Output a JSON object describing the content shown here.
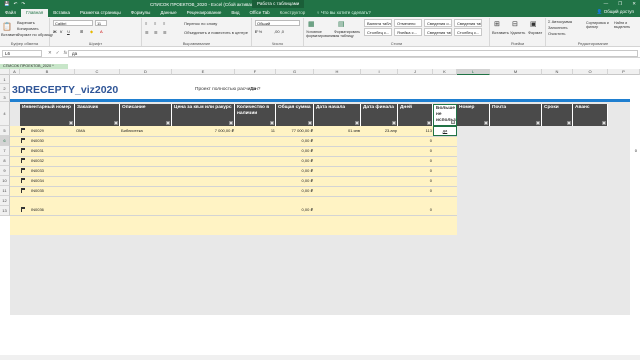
{
  "app": {
    "title": "СПИСОК ПРОЕКТОВ_2020 - Excel (Сбой активации продукта)",
    "context_tab": "Работа с таблицами",
    "window": {
      "minimize": "—",
      "restore": "❐",
      "close": "✕"
    }
  },
  "qat": {
    "save": "💾",
    "undo": "↶",
    "redo": "↷"
  },
  "tabs": [
    "Файл",
    "Главная",
    "Вставка",
    "Разметка страницы",
    "Формулы",
    "Данные",
    "Рецензирование",
    "Вид",
    "Office Tab",
    "Конструктор"
  ],
  "tellme": "♀ Что вы хотите сделать?",
  "share": "👤 Общий доступ",
  "ribbon": {
    "clipboard": {
      "name": "Буфер обмена",
      "paste": "Вставить",
      "cut": "Вырезать",
      "copy": "Копировать",
      "format": "Формат по образцу"
    },
    "font": {
      "name": "Шрифт",
      "font_value": "Calibri",
      "size_value": "11"
    },
    "alignment": {
      "name": "Выравнивание",
      "wrap": "Перенос по слову",
      "merge": "Объединить и поместить в центре"
    },
    "number": {
      "name": "Число",
      "format_value": "Общий"
    },
    "styles": {
      "name": "Стили",
      "conditional": "Условное форматирование",
      "as_table": "Форматировать как таблицу",
      "items": [
        "Валюта табл...",
        "Отмечено",
        "Сведения о...",
        "Сведения табл...",
        "Столбец с...",
        "Ячейка с...",
        "Сведения табл...",
        "Столбец с...",
        "Сведения о...",
        "Ячейка с..."
      ]
    },
    "cells": {
      "name": "Ячейки",
      "insert": "Вставить",
      "delete": "Удалить",
      "format": "Формат"
    },
    "editing": {
      "name": "Редактирование",
      "autosum": "Σ Автосумма",
      "fill": "Заполнить",
      "clear": "Очистить",
      "sort": "Сортировка и фильтр",
      "find": "Найти и выделить"
    }
  },
  "formula_bar": {
    "name_box": "L6",
    "fx": "fx",
    "value": "да"
  },
  "columns": [
    "A",
    "B",
    "C",
    "D",
    "E",
    "F",
    "G",
    "H",
    "I",
    "J",
    "K",
    "L",
    "M",
    "N",
    "O",
    "P"
  ],
  "rows": [
    "1",
    "2",
    "3",
    "4",
    "5",
    "6",
    "7",
    "8",
    "9",
    "10",
    "11",
    "12",
    "13"
  ],
  "selected_col": "L",
  "selected_row": "6",
  "sheet_tab": "СПИСОК ПРОЕКТОВ_2020 *",
  "sheet": {
    "title": "3DRECEPTY_viz2020",
    "prompt_label": "Проект полностью расчитан?",
    "prompt_value": "Да",
    "headers": [
      "Инвентарный номер",
      "Заказчик",
      "Описание",
      "Цена за кв.м или ракурс",
      "Количество в наличии",
      "Общая сумма",
      "Дата начала",
      "Дата финала",
      "Дней",
      "Больше не использ.",
      "Номер",
      "Почта",
      "Сроки",
      "Аванс"
    ],
    "rows": [
      {
        "inv": "IN0029",
        "client": "ОМА",
        "desc": "Библиотека",
        "price": "7 000,00 ₽",
        "qty": "11",
        "sum": "77 000,00 ₽",
        "start": "01.янв",
        "end": "23.апр",
        "days": "113",
        "more": "да",
        "extra": ""
      },
      {
        "inv": "IN0030",
        "client": "",
        "desc": "",
        "price": "",
        "qty": "",
        "sum": "0,00 ₽",
        "start": "",
        "end": "",
        "days": "0",
        "more": "",
        "extra": ""
      },
      {
        "inv": "IN0031",
        "client": "",
        "desc": "",
        "price": "",
        "qty": "",
        "sum": "0,00 ₽",
        "start": "",
        "end": "",
        "days": "0",
        "more": "",
        "extra": "0"
      },
      {
        "inv": "IN0032",
        "client": "",
        "desc": "",
        "price": "",
        "qty": "",
        "sum": "0,00 ₽",
        "start": "",
        "end": "",
        "days": "0",
        "more": "",
        "extra": ""
      },
      {
        "inv": "IN0033",
        "client": "",
        "desc": "",
        "price": "",
        "qty": "",
        "sum": "0,00 ₽",
        "start": "",
        "end": "",
        "days": "0",
        "more": "",
        "extra": ""
      },
      {
        "inv": "IN0034",
        "client": "",
        "desc": "",
        "price": "",
        "qty": "",
        "sum": "0,00 ₽",
        "start": "",
        "end": "",
        "days": "0",
        "more": "",
        "extra": ""
      },
      {
        "inv": "IN0035",
        "client": "",
        "desc": "",
        "price": "",
        "qty": "",
        "sum": "0,00 ₽",
        "start": "",
        "end": "",
        "days": "0",
        "more": "",
        "extra": ""
      },
      {
        "inv": "IN0036",
        "client": "",
        "desc": "",
        "price": "",
        "qty": "",
        "sum": "0,00 ₽",
        "start": "",
        "end": "",
        "days": "0",
        "more": "",
        "extra": ""
      }
    ]
  },
  "colors": {
    "excel_green": "#217346",
    "header_dark": "#4a4a4a",
    "title_blue": "#2f5597",
    "accent_bar": "#1f7fd0",
    "row_fill": "#fff3c4"
  }
}
